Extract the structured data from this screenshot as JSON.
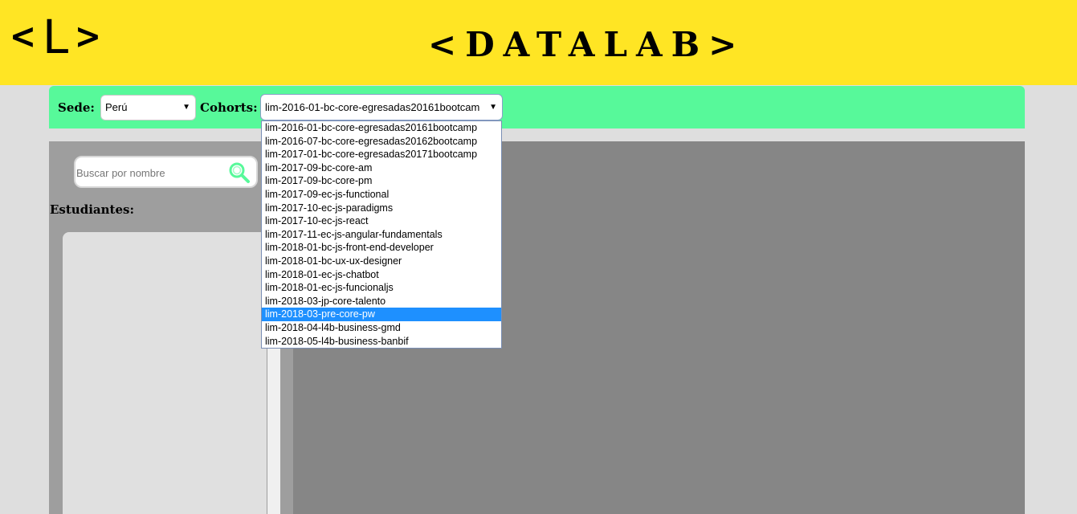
{
  "header": {
    "logo_letter": "L",
    "brand_title": "<DATALAB>"
  },
  "filters": {
    "sede_label": "Sede:",
    "sede_value": "Perú",
    "cohorts_label": "Cohorts:",
    "cohorts_value": "lim-2016-01-bc-core-egresadas20161bootcam"
  },
  "search": {
    "placeholder": "Buscar por nombre",
    "icon": "search-icon"
  },
  "students_label": "Estudiantes:",
  "cohort_options": [
    "lim-2016-01-bc-core-egresadas20161bootcamp",
    "lim-2016-07-bc-core-egresadas20162bootcamp",
    "lim-2017-01-bc-core-egresadas20171bootcamp",
    "lim-2017-09-bc-core-am",
    "lim-2017-09-bc-core-pm",
    "lim-2017-09-ec-js-functional",
    "lim-2017-10-ec-js-paradigms",
    "lim-2017-10-ec-js-react",
    "lim-2017-11-ec-js-angular-fundamentals",
    "lim-2018-01-bc-js-front-end-developer",
    "lim-2018-01-bc-ux-ux-designer",
    "lim-2018-01-ec-js-chatbot",
    "lim-2018-01-ec-js-funcionaljs",
    "lim-2018-03-jp-core-talento",
    "lim-2018-03-pre-core-pw",
    "lim-2018-04-l4b-business-gmd",
    "lim-2018-05-l4b-business-banbif"
  ],
  "highlighted_option_index": 14,
  "colors": {
    "header_bg": "#ffe524",
    "filter_bar_bg": "#57f99a",
    "highlight": "#1e90ff",
    "search_icon": "#57f99a"
  }
}
